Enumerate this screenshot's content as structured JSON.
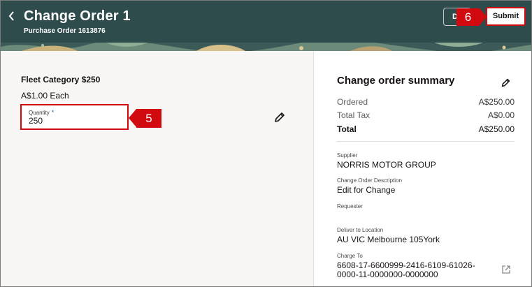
{
  "header": {
    "title": "Change Order 1",
    "subtitle": "Purchase Order 1613876",
    "secondary_button_label": "D",
    "submit_label": "Submit",
    "colors": {
      "banner": "#2f4c4d",
      "callout": "#d10a10"
    }
  },
  "callouts": {
    "submit_step": "6",
    "quantity_step": "5"
  },
  "line": {
    "item_name": "Fleet Category $250",
    "price": "A$1.00 Each",
    "quantity_label": "Quantity",
    "quantity_required_mark": "*",
    "quantity_value": "250"
  },
  "summary": {
    "title": "Change order summary",
    "rows": [
      {
        "label": "Ordered",
        "value": "A$250.00"
      },
      {
        "label": "Total Tax",
        "value": "A$0.00"
      },
      {
        "label": "Total",
        "value": "A$250.00"
      }
    ],
    "supplier_label": "Supplier",
    "supplier_value": "NORRIS MOTOR GROUP",
    "description_label": "Change Order Description",
    "description_value": "Edit for Change",
    "requester_label": "Requester",
    "deliver_label": "Deliver to Location",
    "deliver_value": "AU VIC Melbourne 105York",
    "charge_label": "Charge To",
    "charge_line1": "6608-17-6600999-2416-6109-61026-",
    "charge_line2": "0000-11-0000000-0000000"
  },
  "icons": {
    "back": "chevron-left-icon",
    "edit": "pencil-icon",
    "external": "external-link-icon"
  }
}
